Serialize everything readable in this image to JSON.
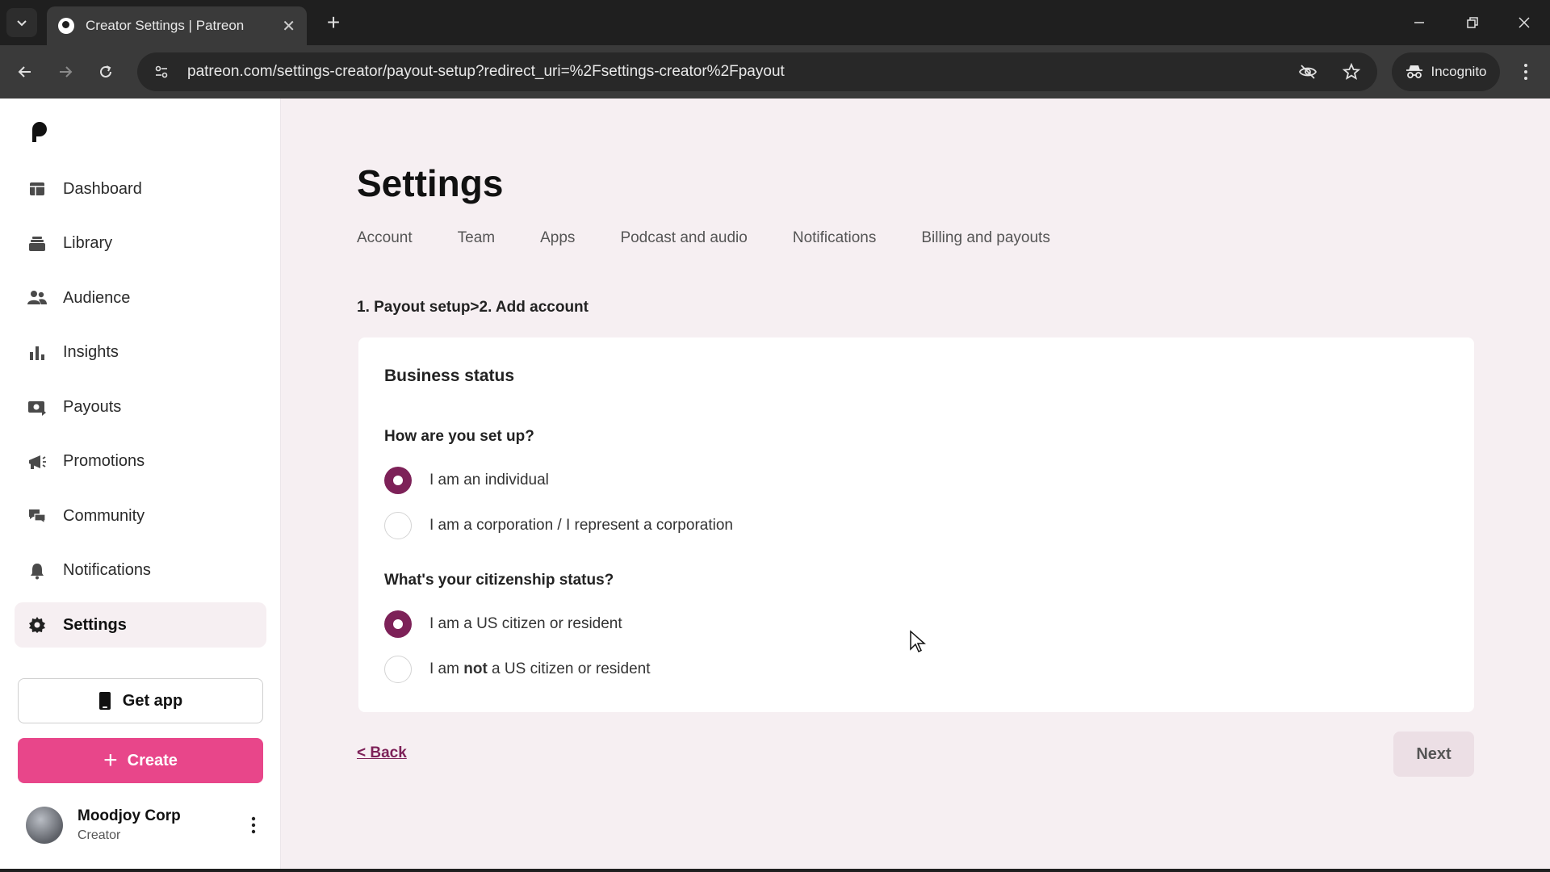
{
  "browser": {
    "tab_title": "Creator Settings | Patreon",
    "url": "patreon.com/settings-creator/payout-setup?redirect_uri=%2Fsettings-creator%2Fpayout",
    "incognito_label": "Incognito"
  },
  "sidebar": {
    "items": [
      {
        "label": "Dashboard",
        "icon": "dashboard-icon"
      },
      {
        "label": "Library",
        "icon": "library-icon"
      },
      {
        "label": "Audience",
        "icon": "audience-icon"
      },
      {
        "label": "Insights",
        "icon": "insights-icon"
      },
      {
        "label": "Payouts",
        "icon": "payouts-icon"
      },
      {
        "label": "Promotions",
        "icon": "promotions-icon"
      },
      {
        "label": "Community",
        "icon": "community-icon"
      },
      {
        "label": "Notifications",
        "icon": "bell-icon"
      },
      {
        "label": "Settings",
        "icon": "gear-icon",
        "active": true
      }
    ],
    "get_app_label": "Get app",
    "create_label": "Create",
    "profile": {
      "name": "Moodjoy Corp",
      "role": "Creator"
    }
  },
  "main": {
    "title": "Settings",
    "tabs": [
      "Account",
      "Team",
      "Apps",
      "Podcast and audio",
      "Notifications",
      "Billing and payouts"
    ],
    "breadcrumb": "1. Payout setup>2. Add account",
    "card": {
      "title": "Business status",
      "q1": "How are you set up?",
      "q1_options": [
        {
          "label": "I am an individual",
          "checked": true
        },
        {
          "label": "I am a corporation / I represent a corporation",
          "checked": false
        }
      ],
      "q2": "What's your citizenship status?",
      "q2_options": [
        {
          "label": "I am a US citizen or resident",
          "checked": true
        },
        {
          "label_pre": "I am ",
          "label_bold": "not",
          "label_post": " a US citizen or resident",
          "checked": false
        }
      ]
    },
    "back_label": "< Back",
    "next_label": "Next"
  },
  "colors": {
    "accent": "#7d2158",
    "create_button": "#e8468a",
    "page_background": "#f6eff2"
  }
}
